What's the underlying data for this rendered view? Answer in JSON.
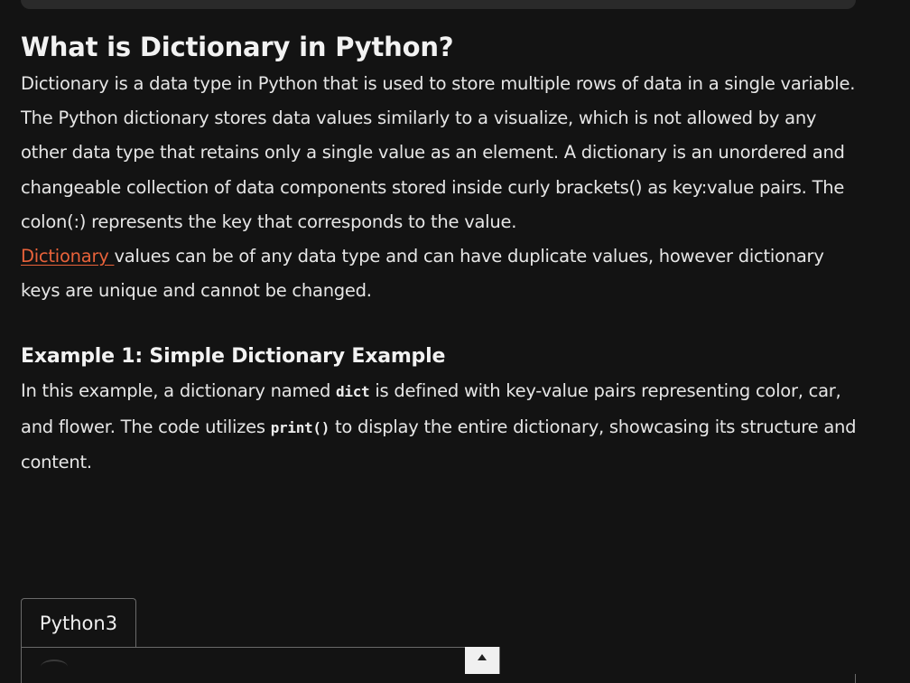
{
  "article": {
    "title": "What is Dictionary in Python?",
    "paragraph1": "Dictionary is a data type in Python that is used to store multiple rows of data in a single variable. The Python dictionary stores data values similarly to a visualize, which is not allowed by any other data type that retains only a single value as an element. A dictionary is an unordered and changeable collection of data components stored inside curly brackets() as key:value pairs. The colon(:) represents the key that corresponds to the value.",
    "paragraph2_link": "Dictionary ",
    "paragraph2_rest": "values can be of any data type and can have duplicate values, however dictionary keys are unique and cannot be changed.",
    "example_heading": "Example 1: Simple Dictionary Example",
    "paragraph3_a": "In this example, a dictionary named ",
    "paragraph3_code1": "dict",
    "paragraph3_b": " is defined with key-value pairs representing color, car, and flower. The code utilizes ",
    "paragraph3_code2": "print()",
    "paragraph3_c": " to display the entire dictionary, showcasing its structure and content."
  },
  "code_block": {
    "tab_label": "Python3"
  },
  "colors": {
    "background": "#131313",
    "link": "#e8623a",
    "text": "#e6e6e6"
  }
}
